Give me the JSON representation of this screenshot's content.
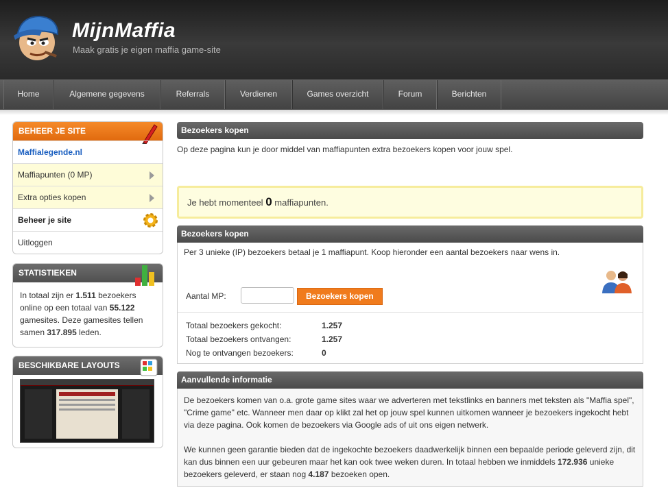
{
  "header": {
    "title": "MijnMaffia",
    "subtitle": "Maak gratis je eigen maffia game-site"
  },
  "nav": [
    {
      "label": "Home",
      "name": "nav-home"
    },
    {
      "label": "Algemene gegevens",
      "name": "nav-algemene-gegevens"
    },
    {
      "label": "Referrals",
      "name": "nav-referrals"
    },
    {
      "label": "Verdienen",
      "name": "nav-verdienen"
    },
    {
      "label": "Games overzicht",
      "name": "nav-games-overzicht"
    },
    {
      "label": "Forum",
      "name": "nav-forum"
    },
    {
      "label": "Berichten",
      "name": "nav-berichten"
    }
  ],
  "sidebar": {
    "manage": {
      "title": "BEHEER JE SITE",
      "site_link": "Maffialegende.nl",
      "items": [
        "Maffiapunten (0 MP)",
        "Extra opties kopen",
        "Beheer je site",
        "Uitloggen"
      ]
    },
    "stats": {
      "title": "STATISTIEKEN",
      "t1": "In totaal zijn er ",
      "online": "1.511",
      "t2": " bezoekers online op een totaal van ",
      "gamesites": "55.122",
      "t3": " gamesites. Deze gamesites tellen samen ",
      "members": "317.895",
      "t4": " leden."
    },
    "layouts": {
      "title": "BESCHIKBARE LAYOUTS"
    }
  },
  "main": {
    "section1": {
      "title": "Bezoekers kopen",
      "intro": "Op deze pagina kun je door middel van maffiapunten extra bezoekers kopen voor jouw spel."
    },
    "notice": {
      "pre": "Je hebt momenteel ",
      "value": "0",
      "post": " maffiapunten."
    },
    "section2": {
      "title": "Bezoekers kopen",
      "text": "Per 3 unieke (IP) bezoekers betaal je 1 maffiapunt. Koop hieronder een aantal bezoekers naar wens in.",
      "input_label": "Aantal MP:",
      "input_value": "",
      "button": "Bezoekers kopen",
      "stats": [
        {
          "label": "Totaal bezoekers gekocht:",
          "value": "1.257"
        },
        {
          "label": "Totaal bezoekers ontvangen:",
          "value": "1.257"
        },
        {
          "label": "Nog te ontvangen bezoekers:",
          "value": "0"
        }
      ]
    },
    "section3": {
      "title": "Aanvullende informatie",
      "p1": "De bezoekers komen van o.a. grote game sites waar we adverteren met tekstlinks en banners met teksten als \"Maffia spel\", \"Crime game\" etc. Wanneer men daar op klikt zal het op jouw spel kunnen uitkomen wanneer je bezoekers ingekocht hebt via deze pagina. Ook komen de bezoekers via Google ads of uit ons eigen netwerk.",
      "p2a": "We kunnen geen garantie bieden dat de ingekochte bezoekers daadwerkelijk binnen een bepaalde periode geleverd zijn, dit kan dus binnen een uur gebeuren maar het kan ook twee weken duren. In totaal hebben we inmiddels ",
      "delivered": "172.936",
      "p2b": " unieke bezoekers geleverd, er staan nog ",
      "open": "4.187",
      "p2c": " bezoeken open."
    }
  }
}
